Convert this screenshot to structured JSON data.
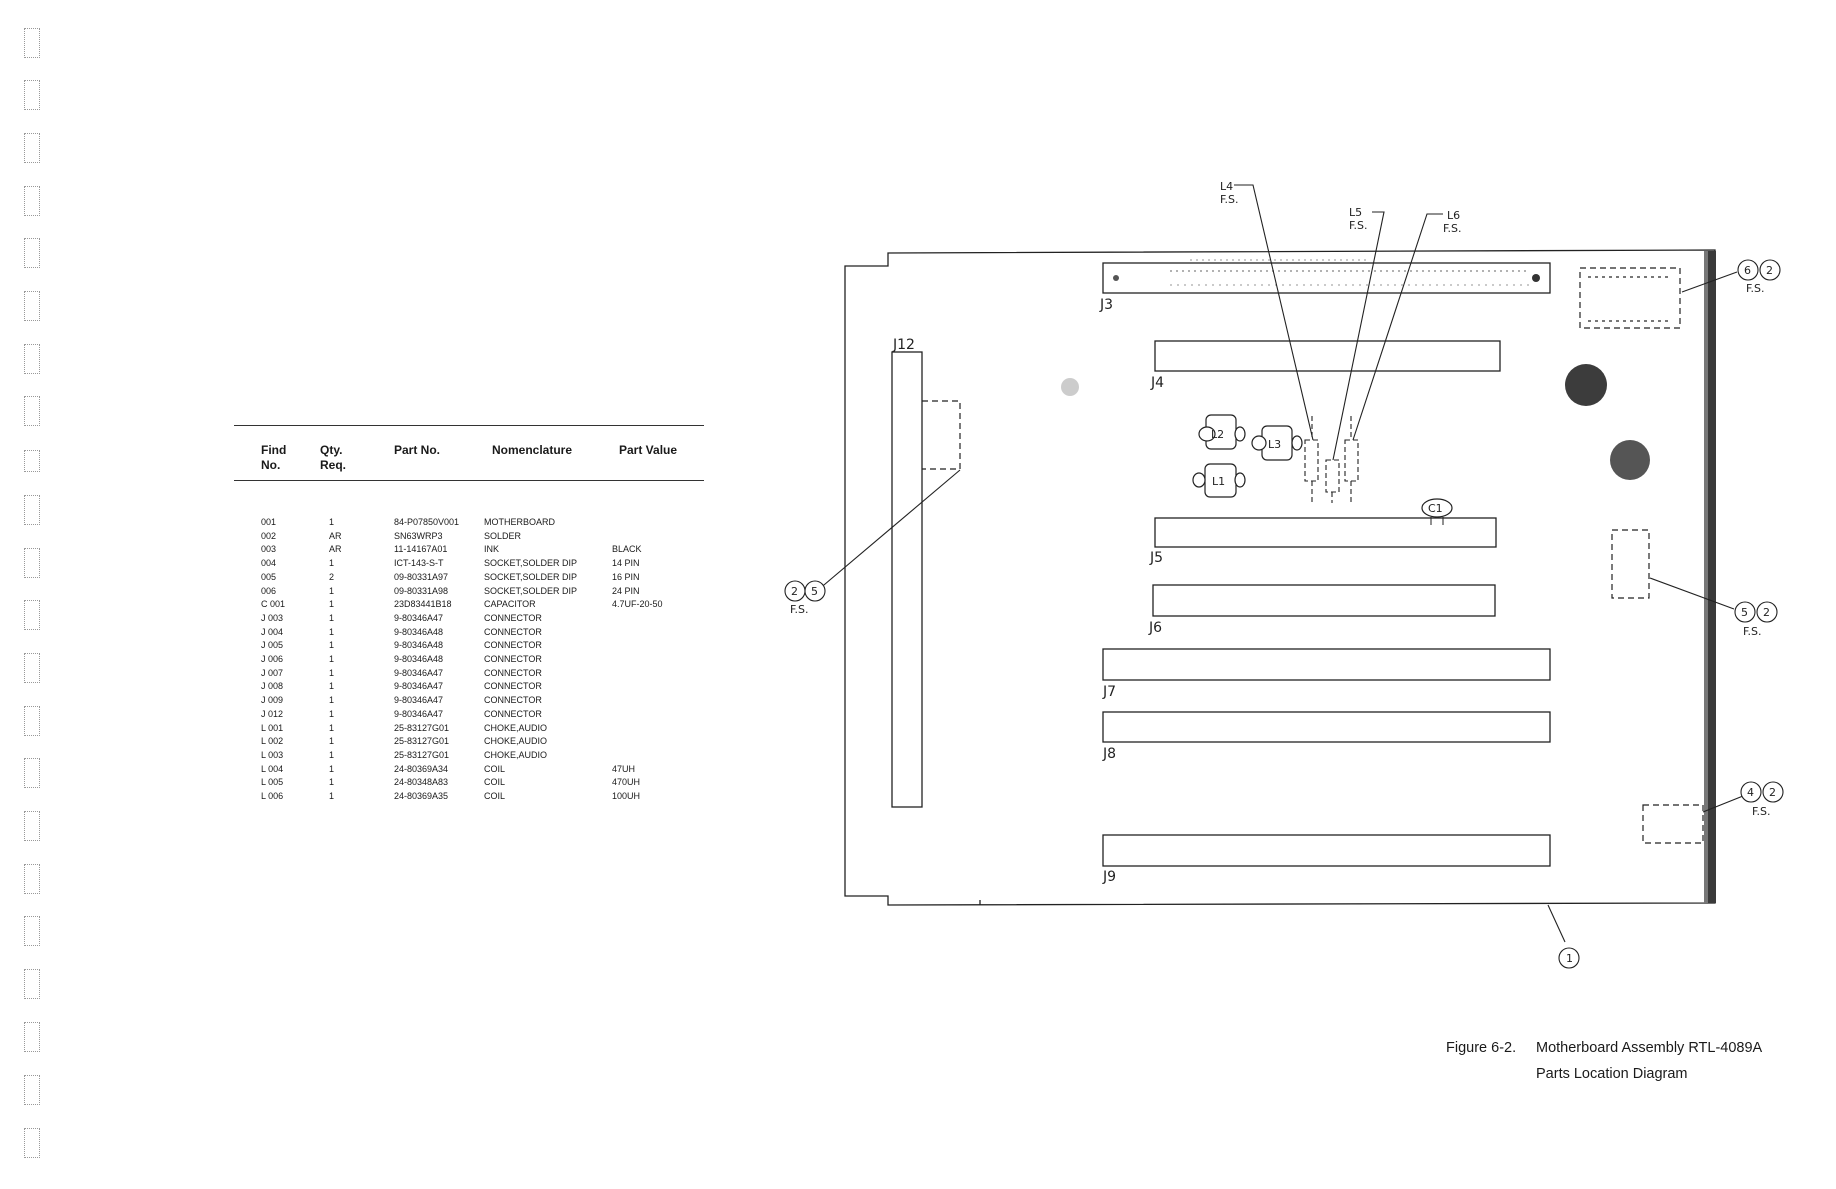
{
  "table": {
    "headers": {
      "find_no": [
        "Find",
        "No."
      ],
      "qty_req": [
        "Qty.",
        "Req."
      ],
      "part_no": "Part No.",
      "nomenclature": "Nomenclature",
      "part_value": "Part Value"
    },
    "rows": [
      {
        "find": "001",
        "qty": "1",
        "part": "84-P07850V001",
        "nom": "MOTHERBOARD",
        "value": ""
      },
      {
        "find": "002",
        "qty": "AR",
        "part": "SN63WRP3",
        "nom": "SOLDER",
        "value": ""
      },
      {
        "find": "003",
        "qty": "AR",
        "part": "11-14167A01",
        "nom": "INK",
        "value": "BLACK"
      },
      {
        "find": "004",
        "qty": "1",
        "part": "ICT-143-S-T",
        "nom": "SOCKET,SOLDER DIP",
        "value": "14 PIN"
      },
      {
        "find": "005",
        "qty": "2",
        "part": "09-80331A97",
        "nom": "SOCKET,SOLDER DIP",
        "value": "16 PIN"
      },
      {
        "find": "006",
        "qty": "1",
        "part": "09-80331A98",
        "nom": "SOCKET,SOLDER DIP",
        "value": "24 PIN"
      },
      {
        "find": "C 001",
        "qty": "1",
        "part": "23D83441B18",
        "nom": "CAPACITOR",
        "value": "4.7UF-20-50"
      },
      {
        "find": "J 003",
        "qty": "1",
        "part": "9-80346A47",
        "nom": "CONNECTOR",
        "value": ""
      },
      {
        "find": "J 004",
        "qty": "1",
        "part": "9-80346A48",
        "nom": "CONNECTOR",
        "value": ""
      },
      {
        "find": "J 005",
        "qty": "1",
        "part": "9-80346A48",
        "nom": "CONNECTOR",
        "value": ""
      },
      {
        "find": "J 006",
        "qty": "1",
        "part": "9-80346A48",
        "nom": "CONNECTOR",
        "value": ""
      },
      {
        "find": "J 007",
        "qty": "1",
        "part": "9-80346A47",
        "nom": "CONNECTOR",
        "value": ""
      },
      {
        "find": "J 008",
        "qty": "1",
        "part": "9-80346A47",
        "nom": "CONNECTOR",
        "value": ""
      },
      {
        "find": "J 009",
        "qty": "1",
        "part": "9-80346A47",
        "nom": "CONNECTOR",
        "value": ""
      },
      {
        "find": "J 012",
        "qty": "1",
        "part": "9-80346A47",
        "nom": "CONNECTOR",
        "value": ""
      },
      {
        "find": "L 001",
        "qty": "1",
        "part": "25-83127G01",
        "nom": "CHOKE,AUDIO",
        "value": ""
      },
      {
        "find": "L 002",
        "qty": "1",
        "part": "25-83127G01",
        "nom": "CHOKE,AUDIO",
        "value": ""
      },
      {
        "find": "L 003",
        "qty": "1",
        "part": "25-83127G01",
        "nom": "CHOKE,AUDIO",
        "value": ""
      },
      {
        "find": "L 004",
        "qty": "1",
        "part": "24-80369A34",
        "nom": "COIL",
        "value": "47UH"
      },
      {
        "find": "L 005",
        "qty": "1",
        "part": "24-80348A83",
        "nom": "COIL",
        "value": "470UH"
      },
      {
        "find": "L 006",
        "qty": "1",
        "part": "24-80369A35",
        "nom": "COIL",
        "value": "100UH"
      }
    ]
  },
  "diagram": {
    "connectors": {
      "j3": "J3",
      "j4": "J4",
      "j5": "J5",
      "j6": "J6",
      "j7": "J7",
      "j8": "J8",
      "j9": "J9",
      "j12": "J12"
    },
    "components": {
      "l1": "L1",
      "l2": "L2",
      "l3": "L3",
      "c1": "C1"
    },
    "callouts": {
      "l4": "L4",
      "l5": "L5",
      "l6": "L6",
      "fs": "F.S.",
      "find_6": "6",
      "find_2": "2",
      "find_5": "5",
      "find_4": "4",
      "find_1": "1"
    }
  },
  "caption": {
    "figure": "Figure 6-2.",
    "title_line1": "Motherboard Assembly RTL-4089A",
    "title_line2": "Parts Location Diagram"
  }
}
